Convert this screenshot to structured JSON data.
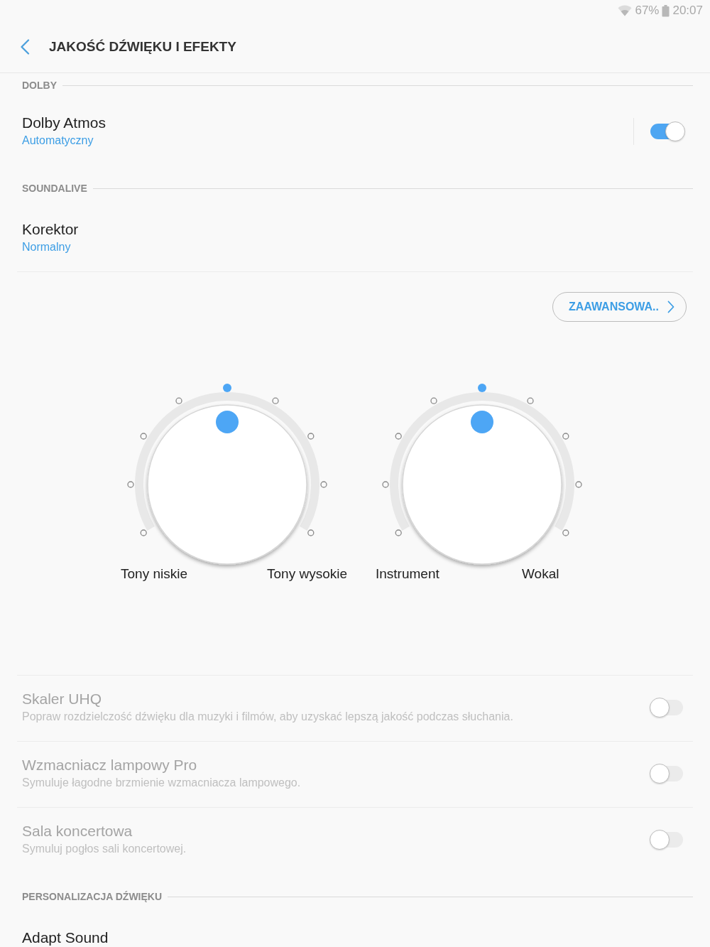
{
  "status_bar": {
    "battery": "67%",
    "time": "20:07"
  },
  "header": {
    "title": "JAKOŚĆ DŹWIĘKU I EFEKTY"
  },
  "content": [
    {
      "kind": "section",
      "title": "DOLBY"
    },
    {
      "kind": "switch",
      "title": "Dolby Atmos",
      "summary": "Automatyczny",
      "on": true,
      "disabled": false
    },
    {
      "kind": "section",
      "title": "SOUNDALIVE"
    },
    {
      "kind": "link",
      "title": "Korektor",
      "summary": "Normalny",
      "disabled": false
    },
    {
      "kind": "equalizer",
      "button": "ZAAWANSOWA..",
      "dials": [
        {
          "left_label": "Tony niskie",
          "right_label": "Tony wysokie",
          "level": 0.5
        },
        {
          "left_label": "Instrument",
          "right_label": "Wokal",
          "level": 0.5
        }
      ]
    },
    {
      "kind": "switch",
      "title": "Skaler UHQ",
      "description": "Popraw rozdzielczość dźwięku dla muzyki i filmów, aby uzyskać lepszą jakość podczas słuchania.",
      "on": false,
      "disabled": true
    },
    {
      "kind": "switch",
      "title": "Wzmacniacz lampowy Pro",
      "description": "Symuluje łagodne brzmienie wzmacniacza lampowego.",
      "on": false,
      "disabled": true
    },
    {
      "kind": "switch",
      "title": "Sala koncertowa",
      "description": "Symuluj pogłos sali koncertowej.",
      "on": false,
      "disabled": true
    },
    {
      "kind": "section",
      "title": "PERSONALIZACJA DŹWIĘKU"
    },
    {
      "kind": "link",
      "title": "Adapt Sound",
      "disabled": false
    }
  ]
}
